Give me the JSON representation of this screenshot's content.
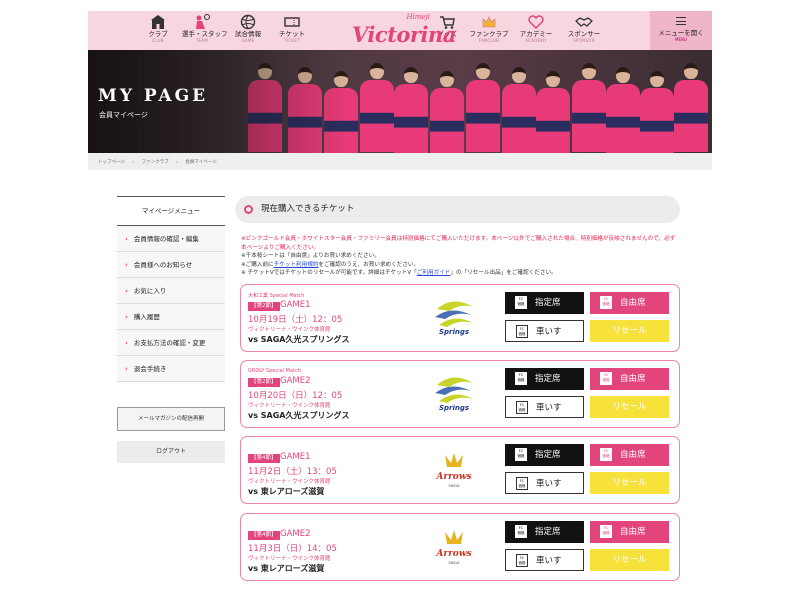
{
  "header": {
    "nav": [
      {
        "label": "クラブ",
        "en": "CLUB",
        "icon": "castle-icon"
      },
      {
        "label": "選手・スタッフ",
        "en": "TEAM",
        "icon": "volleyball-player-icon"
      },
      {
        "label": "試合情報",
        "en": "GAME",
        "icon": "volleyball-icon"
      },
      {
        "label": "チケット",
        "en": "TICKET",
        "icon": "ticket-icon"
      },
      {
        "label": "グッズ",
        "en": "GOODS",
        "icon": "cart-icon"
      },
      {
        "label": "ファンクラブ",
        "en": "FANCLUB",
        "icon": "crown-icon"
      },
      {
        "label": "アカデミー",
        "en": "ACADEMY",
        "icon": "heart-icon"
      },
      {
        "label": "スポンサー",
        "en": "SPONSOR",
        "icon": "handshake-icon"
      }
    ],
    "logo_top": "Himeji",
    "logo_main": "Victorina",
    "menu_label": "メニューを開く",
    "menu_en": "MENU"
  },
  "hero": {
    "title": "MY PAGE",
    "subtitle": "会員マイページ"
  },
  "breadcrumb": [
    "トップページ",
    "ファンクラブ",
    "会員マイページ"
  ],
  "sidebar": {
    "heading": "マイページメニュー",
    "items": [
      "会員情報の確認・編集",
      "会員様へのお知らせ",
      "お気に入り",
      "購入履歴",
      "お支払方法の確認・変更",
      "退会手続き"
    ],
    "mail_button": "メールマガジンの配信再開",
    "logout": "ログアウト"
  },
  "main": {
    "section_title": "現在購入できるチケット",
    "notes": {
      "red": "※ピンクゴールド会員・ホワイトスター会員・ファミリー会員は特別価格にてご購入いただけます。本ページ以外でご購入された場合、特別価格が反映されませんので、必ず本ページよりご購入ください。",
      "l2": "※千本桜シートは「自由席」よりお買い求めください。",
      "l3_pre": "※ご購入前に",
      "l3_link": "チケット利用規約",
      "l3_post": "をご確認のうえ、お買い求めください。",
      "l4_pre": "※ チケットVではチケットのリセールが可能です。詳細はチケットV「",
      "l4_link": "ご利用ガイド",
      "l4_post": "」の「リセール出品」をご確認ください。"
    },
    "buttons": {
      "fc_top": "FC",
      "fc_bottom": "価格",
      "reserved": "指定席",
      "free": "自由席",
      "wheelchair": "車いす",
      "resale": "リセール"
    },
    "cards": [
      {
        "special": "大和工業 Special Match",
        "round": "【第2節】",
        "game": "GAME1",
        "date": "10月19日（土）12：05",
        "venue": "ヴィクトリーナ・ウインク体育館",
        "opponent": "vs SAGA久光スプリングス",
        "logo": "springs"
      },
      {
        "special": "GROLY Special Match",
        "round": "【第2節】",
        "game": "GAME2",
        "date": "10月20日（日）12：05",
        "venue": "ヴィクトリーナ・ウインク体育館",
        "opponent": "vs SAGA久光スプリングス",
        "logo": "springs"
      },
      {
        "special": "",
        "round": "【第4節】",
        "game": "GAME1",
        "date": "11月2日（土）13：05",
        "venue": "ヴィクトリーナ・ウインク体育館",
        "opponent": "vs 東レアローズ滋賀",
        "logo": "arrows"
      },
      {
        "special": "",
        "round": "【第4節】",
        "game": "GAME2",
        "date": "11月3日（日）14：05",
        "venue": "ヴィクトリーナ・ウインク体育館",
        "opponent": "vs 東レアローズ滋賀",
        "logo": "arrows"
      }
    ]
  },
  "colors": {
    "accent": "#e2457c",
    "header_bg": "#f7d6e0",
    "resale": "#f6e23a"
  }
}
